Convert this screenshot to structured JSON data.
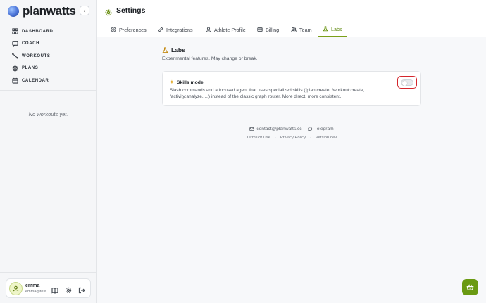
{
  "brand": {
    "name": "planwatts",
    "collapse_icon": "chevron-left-icon"
  },
  "sidebar": {
    "items": [
      {
        "label": "DASHBOARD",
        "icon": "grid-icon"
      },
      {
        "label": "COACH",
        "icon": "chat-icon"
      },
      {
        "label": "WORKOUTS",
        "icon": "activity-icon"
      },
      {
        "label": "PLANS",
        "icon": "layers-icon"
      },
      {
        "label": "CALENDAR",
        "icon": "calendar-icon"
      }
    ],
    "empty_text": "No workouts yet."
  },
  "user": {
    "name": "emma",
    "email": "emma@test..."
  },
  "header": {
    "title": "Settings",
    "icon": "gear-icon"
  },
  "tabs": [
    {
      "label": "Preferences",
      "icon": "sliders-icon"
    },
    {
      "label": "Integrations",
      "icon": "link-icon"
    },
    {
      "label": "Athlete Profile",
      "icon": "person-icon"
    },
    {
      "label": "Billing",
      "icon": "card-icon"
    },
    {
      "label": "Team",
      "icon": "team-icon"
    },
    {
      "label": "Labs",
      "icon": "flask-icon",
      "active": true
    }
  ],
  "labs": {
    "title": "Labs",
    "subtitle": "Experimental features. May change or break.",
    "feature": {
      "title": "Skills mode",
      "description": "Slash commands and a focused agent that uses specialized skills (/plan:create, /workout:create, /activity:analyze, ...) instead of the classic graph router. More direct, more consistent.",
      "enabled": false
    }
  },
  "footer": {
    "email": "contact@planwatts.cc",
    "telegram": "Telegram",
    "terms": "Terms of Use",
    "privacy": "Privacy Policy",
    "version": "Version dev"
  },
  "colors": {
    "accent": "#6a9a12",
    "highlight": "#d4262c"
  }
}
